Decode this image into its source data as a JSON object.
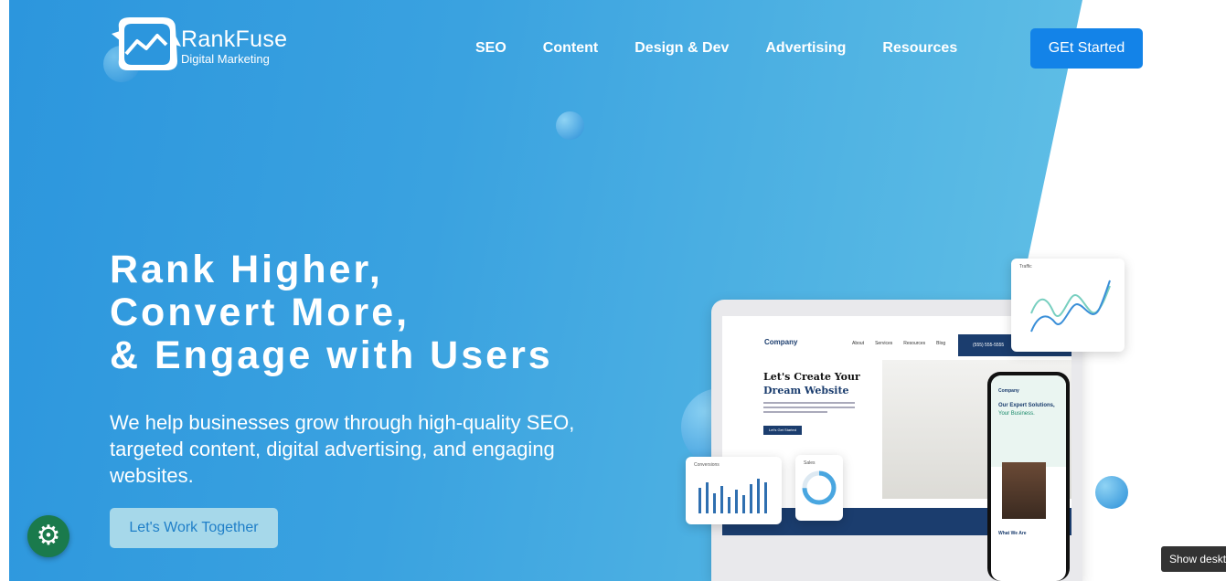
{
  "brand": {
    "name": "RankFuse",
    "tagline": "Digital Marketing"
  },
  "nav": {
    "items": [
      "SEO",
      "Content",
      "Design & Dev",
      "Advertising",
      "Resources"
    ]
  },
  "header": {
    "cta_label": "GEt Started"
  },
  "hero": {
    "headline": [
      "Rank Higher,",
      "Convert More,",
      "& Engage with Users"
    ],
    "subtext": "We help businesses grow through high-quality SEO, targeted content, digital advertising, and engaging websites.",
    "cta_label": "Let's Work Together"
  },
  "mockup": {
    "site_logo": "Company",
    "site_nav": [
      "About",
      "Services",
      "Resources",
      "Blog"
    ],
    "site_phone": "(555) 555-5555",
    "site_title_line1": "Let's Create Your",
    "site_title_line2": "Dream Website",
    "site_button": "Let's Get Started",
    "traffic_label": "Traffic",
    "conversions_label": "Conversions",
    "sales_label": "Sales",
    "phone_logo": "Company",
    "phone_title": "Our Expert Solutions,",
    "phone_subtitle": "Your Business.",
    "phone_section": "What We Are"
  },
  "colors": {
    "accent": "#1383e8",
    "hero_start": "#2c96dd",
    "hero_end": "#6cc6ea",
    "settings": "#1a7a4c",
    "mock_navy": "#1b3d6e"
  },
  "icons": {
    "settings": "gear-icon",
    "logo": "chart-badge-icon"
  },
  "tooltip": {
    "text": "Show desktop"
  }
}
